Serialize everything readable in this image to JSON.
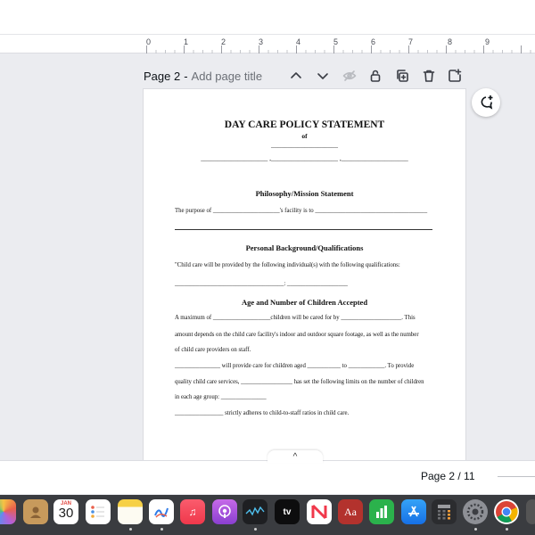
{
  "ruler": {
    "labels": [
      "0",
      "1",
      "2",
      "3",
      "4",
      "5",
      "6",
      "7",
      "8",
      "9"
    ]
  },
  "page_header": {
    "label": "Page 2",
    "separator": "-",
    "title_placeholder": "Add page title"
  },
  "toolbar": {
    "icons": [
      "chevron-up-icon",
      "chevron-down-icon",
      "hide-icon",
      "lock-icon",
      "duplicate-icon",
      "trash-icon",
      "add-page-icon"
    ]
  },
  "document": {
    "title": "DAY CARE POLICY STATEMENT",
    "of": "of",
    "blank_line_1": "____________________",
    "blank_line_2": "____________________ ,____________________ ,____________________",
    "section1_heading": "Philosophy/Mission Statement",
    "section1_line1": "The purpose of ______________________'s facility is to _____________________________________",
    "section2_heading": "Personal Background/Qualifications",
    "section2_line1": "\"Child care will be provided by the following individual(s) with the following qualifications:",
    "section2_line2": "____________________________________: ____________________",
    "section3_heading": "Age and Number of Children Accepted",
    "section3_lines": [
      "A maximum of ___________________children will be cared for by ____________________. This",
      "amount depends on the child care facility's indoor and outdoor square footage, as well as the number",
      "of child care providers on staff.",
      "_______________ will provide care for children aged ___________ to ____________. To provide",
      "quality child care services, _________________ has set the following limits on the number of children",
      "in each age group: _______________",
      "________________ strictly adheres to child-to-staff ratios in child care."
    ]
  },
  "bottom_bar": {
    "expand_icon": "^",
    "page_count": "Page 2 / 11"
  },
  "dock": {
    "calendar_month": "JAN",
    "calendar_day": "30",
    "dictionary_label": "Aa",
    "apps": [
      "photos",
      "contacts",
      "calendar",
      "reminders",
      "notes",
      "freeform",
      "music",
      "podcasts",
      "stocks",
      "tv",
      "news",
      "dictionary",
      "numbers",
      "app-store",
      "calculator",
      "system-settings",
      "chrome"
    ]
  }
}
